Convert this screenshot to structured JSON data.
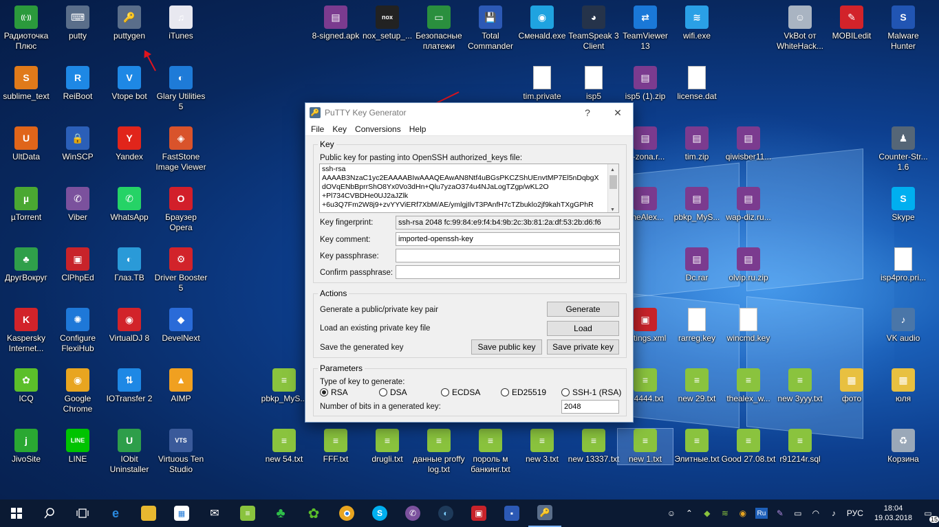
{
  "desktop": {
    "icons": [
      {
        "label": "Радиоточка Плюс",
        "glyph": "((·))",
        "color": "#2b9a3c"
      },
      {
        "label": "putty",
        "glyph": "⌨",
        "color": "#5a6e8a"
      },
      {
        "label": "puttygen",
        "glyph": "🔑",
        "color": "#5a6e8a"
      },
      {
        "label": "iTunes",
        "glyph": "♫",
        "color": "#e8e8f0"
      },
      {
        "label": "8-signed.apk",
        "glyph": "▤",
        "color": "#7b3b8f"
      },
      {
        "label": "nox_setup_...",
        "glyph": "nox",
        "color": "#222222"
      },
      {
        "label": "Безопасные платежи",
        "glyph": "▭",
        "color": "#2a8f3e"
      },
      {
        "label": "Total Commander",
        "glyph": "💾",
        "color": "#2c59b5"
      },
      {
        "label": "Сменаld.exe",
        "glyph": "◉",
        "color": "#1fa3e0"
      },
      {
        "label": "TeamSpeak 3 Client",
        "glyph": "◕",
        "color": "#25334a"
      },
      {
        "label": "TeamViewer 13",
        "glyph": "⇄",
        "color": "#1a78d8"
      },
      {
        "label": "wifi.exe",
        "glyph": "≋",
        "color": "#2aa0e6"
      },
      {
        "label": "VkBot от WhiteHack...",
        "glyph": "☺",
        "color": "#a9b4c2"
      },
      {
        "label": "MOBILedit",
        "glyph": "✎",
        "color": "#d2232a"
      },
      {
        "label": "Malware Hunter",
        "glyph": "S",
        "color": "#2155b3"
      },
      {
        "label": "sublime_text",
        "glyph": "S",
        "color": "#e07a1a"
      },
      {
        "label": "ReiBoot",
        "glyph": "R",
        "color": "#1e88e5"
      },
      {
        "label": "Vtope bot",
        "glyph": "V",
        "color": "#1e88e5"
      },
      {
        "label": "Glary Utilities 5",
        "glyph": "◐",
        "color": "#1e7bd8"
      },
      {
        "label": "tim.private",
        "glyph": "",
        "color": "#ffffff"
      },
      {
        "label": "isp5",
        "glyph": "",
        "color": "#ffffff"
      },
      {
        "label": "isp5 (1).zip",
        "glyph": "▤",
        "color": "#7b3b8f"
      },
      {
        "label": "license.dat",
        "glyph": "",
        "color": "#ffffff"
      },
      {
        "label": "UltData",
        "glyph": "U",
        "color": "#e0651a"
      },
      {
        "label": "WinSCP",
        "glyph": "🔒",
        "color": "#2b5fb8"
      },
      {
        "label": "Yandex",
        "glyph": "Y",
        "color": "#e1251b"
      },
      {
        "label": "FastStone Image Viewer",
        "glyph": "◈",
        "color": "#d9532b"
      },
      {
        "label": "...-zona.r...",
        "glyph": "▤",
        "color": "#7b3b8f"
      },
      {
        "label": "tim.zip",
        "glyph": "▤",
        "color": "#7b3b8f"
      },
      {
        "label": "qiwisber11...",
        "glyph": "▤",
        "color": "#7b3b8f"
      },
      {
        "label": "Counter-Str... 1.6",
        "glyph": "♟",
        "color": "#556677"
      },
      {
        "label": "µTorrent",
        "glyph": "µ",
        "color": "#4aa832"
      },
      {
        "label": "Viber",
        "glyph": "✆",
        "color": "#7b519d"
      },
      {
        "label": "WhatsApp",
        "glyph": "✆",
        "color": "#25d366"
      },
      {
        "label": "Браузер Opera",
        "glyph": "O",
        "color": "#d21f2a"
      },
      {
        "label": "TheAlex...",
        "glyph": "▤",
        "color": "#7b3b8f"
      },
      {
        "label": "pbkp_MyS...",
        "glyph": "▤",
        "color": "#7b3b8f"
      },
      {
        "label": "wap-diz.ru...",
        "glyph": "▤",
        "color": "#7b3b8f"
      },
      {
        "label": "Skype",
        "glyph": "S",
        "color": "#00aff0"
      },
      {
        "label": "ДругВокруг",
        "glyph": "♣",
        "color": "#2f9f4a"
      },
      {
        "label": "ClPhpEd",
        "glyph": "▣",
        "color": "#c8232a"
      },
      {
        "label": "Глаз.ТВ",
        "glyph": "◐",
        "color": "#2a9ad8"
      },
      {
        "label": "Driver Booster 5",
        "glyph": "⚙",
        "color": "#d2232a"
      },
      {
        "label": "Dc.rar",
        "glyph": "▤",
        "color": "#7b3b8f"
      },
      {
        "label": "olvip.ru.zip",
        "glyph": "▤",
        "color": "#7b3b8f"
      },
      {
        "label": "isp4pro.pri...",
        "glyph": "",
        "color": "#ffffff"
      },
      {
        "label": "Kaspersky Internet...",
        "glyph": "K",
        "color": "#d2232a"
      },
      {
        "label": "Configure FlexiHub",
        "glyph": "✺",
        "color": "#1e78d8"
      },
      {
        "label": "VirtualDJ 8",
        "glyph": "◉",
        "color": "#d2232a"
      },
      {
        "label": "DevelNext",
        "glyph": "◆",
        "color": "#2a6bd8"
      },
      {
        "label": "...ttings.xml",
        "glyph": "▣",
        "color": "#c8232a"
      },
      {
        "label": "rarreg.key",
        "glyph": "",
        "color": "#ffffff"
      },
      {
        "label": "wincmd.key",
        "glyph": "",
        "color": "#ffffff"
      },
      {
        "label": "VK audio",
        "glyph": "♪",
        "color": "#4a76a8"
      },
      {
        "label": "ICQ",
        "glyph": "✿",
        "color": "#5bbf2a"
      },
      {
        "label": "Google Chrome",
        "glyph": "◉",
        "color": "#e8a520"
      },
      {
        "label": "IOTransfer 2",
        "glyph": "⇅",
        "color": "#1e88e5"
      },
      {
        "label": "AIMP",
        "glyph": "▲",
        "color": "#f0a020"
      },
      {
        "label": "pbkp_MyS...",
        "glyph": "≡",
        "color": "#8ac33e"
      },
      {
        "label": "...4444.txt",
        "glyph": "≡",
        "color": "#8ac33e"
      },
      {
        "label": "new 29.txt",
        "glyph": "≡",
        "color": "#8ac33e"
      },
      {
        "label": "thealex_w...",
        "glyph": "≡",
        "color": "#8ac33e"
      },
      {
        "label": "new 3yyy.txt",
        "glyph": "≡",
        "color": "#8ac33e"
      },
      {
        "label": "фото",
        "glyph": "▦",
        "color": "#e8c040"
      },
      {
        "label": "юля",
        "glyph": "▦",
        "color": "#e8c040"
      },
      {
        "label": "JivoSite",
        "glyph": "j",
        "color": "#2aa832"
      },
      {
        "label": "LINE",
        "glyph": "LINE",
        "color": "#00c300"
      },
      {
        "label": "IObit Uninstaller",
        "glyph": "U",
        "color": "#2e9e4a"
      },
      {
        "label": "Virtuous Ten Studio",
        "glyph": "VTS",
        "color": "#3a5a9a"
      },
      {
        "label": "new 54.txt",
        "glyph": "≡",
        "color": "#8ac33e"
      },
      {
        "label": "FFF.txt",
        "glyph": "≡",
        "color": "#8ac33e"
      },
      {
        "label": "drugli.txt",
        "glyph": "≡",
        "color": "#8ac33e"
      },
      {
        "label": "данные proffy log.txt",
        "glyph": "≡",
        "color": "#8ac33e"
      },
      {
        "label": "пороль м банкинг.txt",
        "glyph": "≡",
        "color": "#8ac33e"
      },
      {
        "label": "new 3.txt",
        "glyph": "≡",
        "color": "#8ac33e"
      },
      {
        "label": "new 13337.txt",
        "glyph": "≡",
        "color": "#8ac33e"
      },
      {
        "label": "new 1.txt",
        "glyph": "≡",
        "color": "#8ac33e"
      },
      {
        "label": "Элитные.txt",
        "glyph": "≡",
        "color": "#8ac33e"
      },
      {
        "label": "Good 27.08.txt",
        "glyph": "≡",
        "color": "#8ac33e"
      },
      {
        "label": "r91214r.sql",
        "glyph": "≡",
        "color": "#8ac33e"
      },
      {
        "label": "Корзина",
        "glyph": "♻",
        "color": "#9aa8b8"
      }
    ],
    "selected_icon": "new 1.txt"
  },
  "puttygen": {
    "title": "PuTTY Key Generator",
    "title_buttons": {
      "help": "?",
      "close": "✕"
    },
    "menu": [
      "File",
      "Key",
      "Conversions",
      "Help"
    ],
    "key_group": {
      "title": "Key",
      "public_key_label": "Public key for pasting into OpenSSH authorized_keys file:",
      "public_key_lines": [
        "ssh-rsa",
        "AAAAB3NzaC1yc2EAAAABIwAAAQEAwAN8Ntf4uBGsPKCZShUEnvtMP7El5nDqbgX",
        "dOVqENbBprrShO8Yx0Vo3dHn+Qlu7yzaO374u4NJaLogTZgp/wKL2O",
        "+Pl734CVBDHe0UJ2aJZlk",
        "+6u3Q7Fm2W8j9+zvYYViERf7XbM/AE/ymlgjIlvT3PAnfH7cTZbuklo2jf9kahTXgGPhR"
      ],
      "fingerprint_label": "Key fingerprint:",
      "fingerprint_value": "ssh-rsa 2048 fc:99:84:e9:f4:b4:9b:2c:3b:81:2a:df:53:2b:d6:f6",
      "comment_label": "Key comment:",
      "comment_value": "imported-openssh-key",
      "passphrase_label": "Key passphrase:",
      "passphrase_value": "",
      "confirm_label": "Confirm passphrase:",
      "confirm_value": ""
    },
    "actions_group": {
      "title": "Actions",
      "generate_label": "Generate a public/private key pair",
      "generate_button": "Generate",
      "load_label": "Load an existing private key file",
      "load_button": "Load",
      "save_label": "Save the generated key",
      "save_public_button": "Save public key",
      "save_private_button": "Save private key"
    },
    "params_group": {
      "title": "Parameters",
      "type_label": "Type of key to generate:",
      "types": [
        "RSA",
        "DSA",
        "ECDSA",
        "ED25519",
        "SSH-1 (RSA)"
      ],
      "selected_type": "RSA",
      "bits_label": "Number of bits in a generated key:",
      "bits_value": "2048"
    }
  },
  "taskbar": {
    "language": "РУС",
    "time": "18:04",
    "date": "19.03.2018",
    "notifications": "15",
    "tray_ru": "Ru"
  }
}
